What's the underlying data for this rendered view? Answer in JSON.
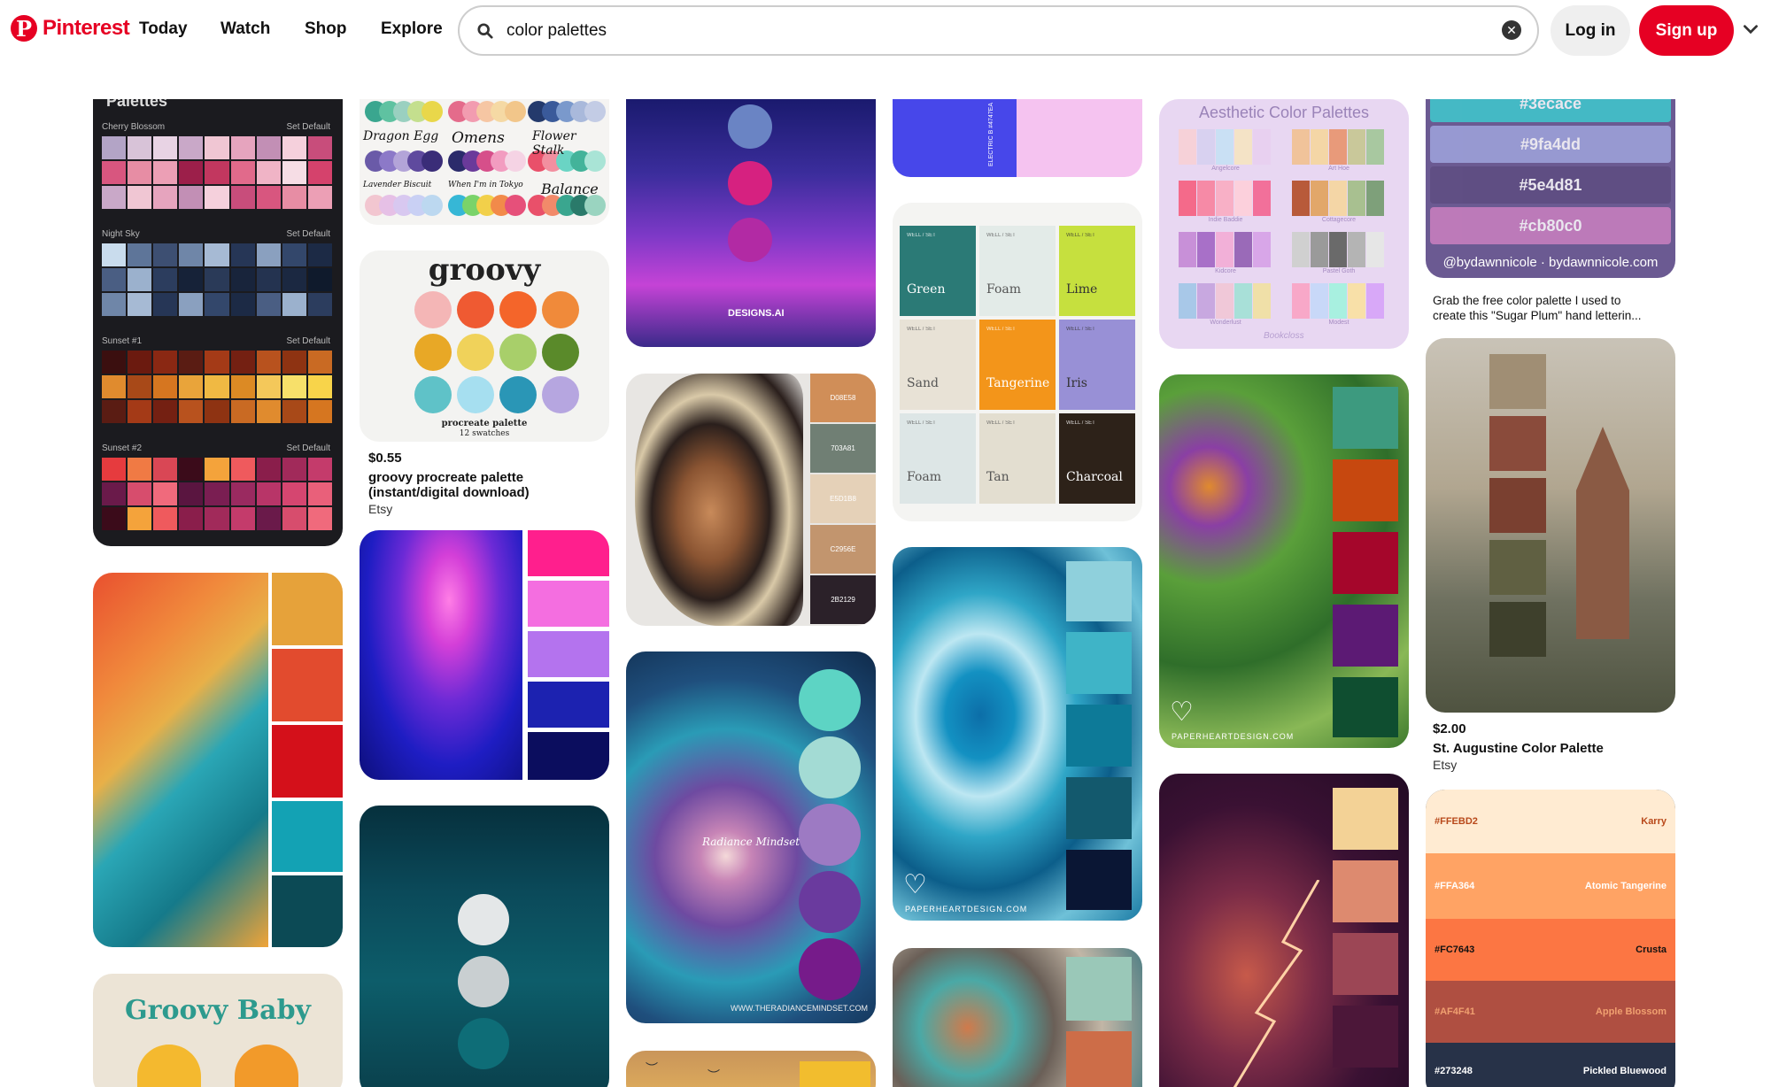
{
  "header": {
    "logo_text": "Pinterest",
    "nav": [
      "Today",
      "Watch",
      "Shop",
      "Explore"
    ],
    "search_value": "color palettes",
    "login_label": "Log in",
    "signup_label": "Sign up"
  },
  "colors": {
    "brand": "#e60023"
  },
  "pins": {
    "procreate": {
      "header": "Palettes",
      "rows": [
        {
          "name": "Cherry Blossom",
          "action": "Set Default"
        },
        {
          "name": "Night Sky",
          "action": "Set Default"
        },
        {
          "name": "Sunset #1",
          "action": "Set Default"
        },
        {
          "name": "Sunset #2",
          "action": "Set Default"
        }
      ]
    },
    "groovy_baby": {
      "title": "Groovy Baby"
    },
    "hand_palette": {
      "labels": [
        "Dragon Egg",
        "Omens",
        "Flower Stalk",
        "Lavender Biscuit",
        "When I'm in Tokyo",
        "Balance"
      ]
    },
    "groovy": {
      "card_title": "groovy",
      "card_sub1": "procreate palette",
      "card_sub2": "12 swatches",
      "price": "$0.55",
      "title1": "groovy procreate palette",
      "title2": "(instant/digital download)",
      "source": "Etsy"
    },
    "neon_city": {
      "watermark": "DESIGNS.AI"
    },
    "butterfly": {
      "codes": [
        "D08E58",
        "703A81",
        "E5D1B8",
        "C2956E",
        "2B2129"
      ]
    },
    "lily": {
      "watermark": "WWW.THERADIANCEMINDSET.COM",
      "logo": "Radiance Mindset"
    },
    "electro": {
      "text1": "ELECTRIC B #4747EA"
    },
    "well_set": {
      "names": [
        "Green",
        "Foam",
        "Lime",
        "Sand",
        "Tangerine",
        "Iris",
        "Foam",
        "Tan",
        "Charcoal"
      ],
      "tag": "WELL / SET"
    },
    "geode": {
      "watermark": "PAPERHEARTDESIGN.COM"
    },
    "aesthetic": {
      "title": "Aesthetic Color Palettes",
      "names": [
        "Angelcore",
        "Art Hoe",
        "Indie Baddie",
        "Cottagecore",
        "Kidcore",
        "Pastel Goth",
        "Wonderlust",
        "Modest"
      ],
      "credit": "Bookcloss"
    },
    "flowers": {
      "watermark": "PAPERHEARTDESIGN.COM"
    },
    "sugar_plum": {
      "codes": [
        "#3ecace",
        "#9fa4dd",
        "#5e4d81",
        "#cb80c0"
      ],
      "credit": "@bydawnnicole · bydawnnicole.com",
      "desc1": "Grab the free color palette I used to",
      "desc2": "create this \"Sugar Plum\" hand letterin..."
    },
    "augustine": {
      "price": "$2.00",
      "title": "St. Augustine Color Palette",
      "source": "Etsy"
    },
    "karry": {
      "rows": [
        {
          "code": "#FFEBD2",
          "name": "Karry"
        },
        {
          "code": "#FFA364",
          "name": "Atomic Tangerine"
        },
        {
          "code": "#FC7643",
          "name": "Crusta"
        },
        {
          "code": "#AF4F41",
          "name": "Apple Blossom"
        },
        {
          "code": "#273248",
          "name": "Pickled Bluewood"
        }
      ]
    }
  }
}
